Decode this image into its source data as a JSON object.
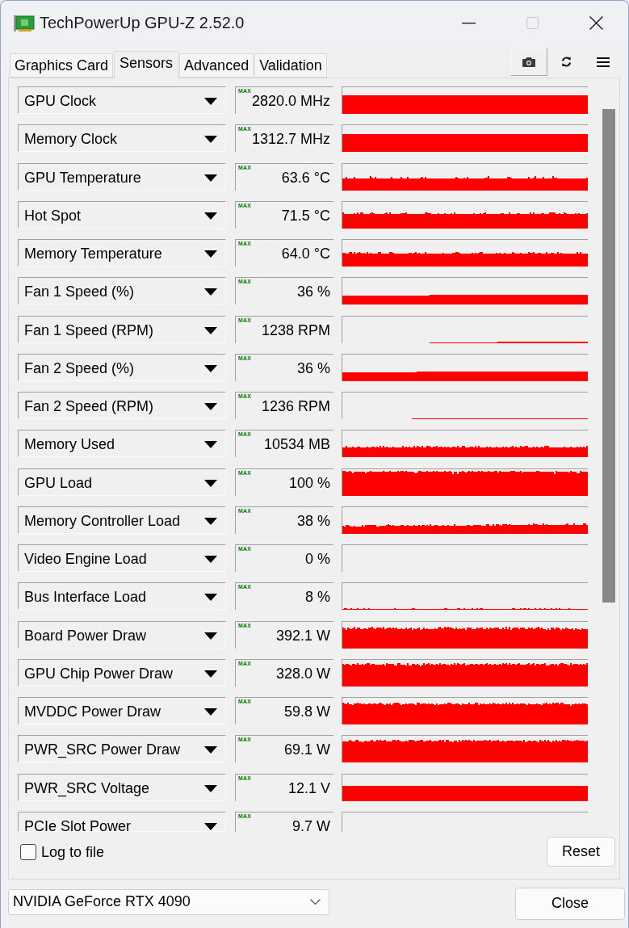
{
  "window": {
    "title": "TechPowerUp GPU-Z 2.52.0",
    "maximize_disabled": true
  },
  "tabs": [
    {
      "label": "Graphics Card",
      "selected": false
    },
    {
      "label": "Sensors",
      "selected": true
    },
    {
      "label": "Advanced",
      "selected": false
    },
    {
      "label": "Validation",
      "selected": false
    }
  ],
  "sensors": [
    {
      "name": "GPU Clock",
      "mode": "MAX",
      "value": "2820.0 MHz"
    },
    {
      "name": "Memory Clock",
      "mode": "MAX",
      "value": "1312.7 MHz"
    },
    {
      "name": "GPU Temperature",
      "mode": "MAX",
      "value": "63.6 °C"
    },
    {
      "name": "Hot Spot",
      "mode": "MAX",
      "value": "71.5 °C"
    },
    {
      "name": "Memory Temperature",
      "mode": "MAX",
      "value": "64.0 °C"
    },
    {
      "name": "Fan 1 Speed (%)",
      "mode": "MAX",
      "value": "36 %"
    },
    {
      "name": "Fan 1 Speed (RPM)",
      "mode": "MAX",
      "value": "1238 RPM"
    },
    {
      "name": "Fan 2 Speed (%)",
      "mode": "MAX",
      "value": "36 %"
    },
    {
      "name": "Fan 2 Speed (RPM)",
      "mode": "MAX",
      "value": "1236 RPM"
    },
    {
      "name": "Memory Used",
      "mode": "MAX",
      "value": "10534 MB"
    },
    {
      "name": "GPU Load",
      "mode": "MAX",
      "value": "100 %"
    },
    {
      "name": "Memory Controller Load",
      "mode": "MAX",
      "value": "38 %"
    },
    {
      "name": "Video Engine Load",
      "mode": "MAX",
      "value": "0 %"
    },
    {
      "name": "Bus Interface Load",
      "mode": "MAX",
      "value": "8 %"
    },
    {
      "name": "Board Power Draw",
      "mode": "MAX",
      "value": "392.1 W"
    },
    {
      "name": "GPU Chip Power Draw",
      "mode": "MAX",
      "value": "328.0 W"
    },
    {
      "name": "MVDDC Power Draw",
      "mode": "MAX",
      "value": "59.8 W"
    },
    {
      "name": "PWR_SRC Power Draw",
      "mode": "MAX",
      "value": "69.1 W"
    },
    {
      "name": "PWR_SRC Voltage",
      "mode": "MAX",
      "value": "12.1 V"
    },
    {
      "name": "PCIe Slot Power",
      "mode": "MAX",
      "value": "9.7 W"
    }
  ],
  "log_to_file": {
    "label": "Log to file",
    "checked": false
  },
  "reset_button": "Reset",
  "gpu_select": {
    "value": "NVIDIA GeForce RTX 4090"
  },
  "close_button": "Close"
}
